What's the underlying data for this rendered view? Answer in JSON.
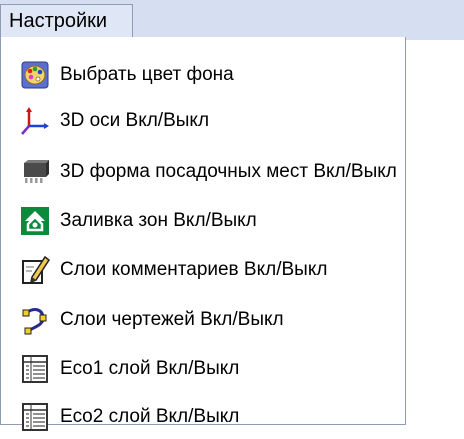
{
  "menu": {
    "title": "Настройки",
    "items": [
      {
        "label": "Выбрать цвет фона",
        "icon": "palette-icon"
      },
      {
        "label": "3D оси Вкл/Выкл",
        "icon": "3d-axes-icon"
      },
      {
        "label": "3D форма посадочных мест Вкл/Выкл",
        "icon": "3d-footprint-icon"
      },
      {
        "label": "Заливка зон Вкл/Выкл",
        "icon": "zone-fill-icon"
      },
      {
        "label": "Слои комментариев Вкл/Выкл",
        "icon": "comment-layer-icon"
      },
      {
        "label": "Слои чертежей Вкл/Выкл",
        "icon": "drawing-layer-icon"
      },
      {
        "label": "Eco1 слой Вкл/Выкл",
        "icon": "eco-layer-icon"
      },
      {
        "label": "Eco2 слой Вкл/Выкл",
        "icon": "eco-layer-icon"
      }
    ]
  },
  "colors": {
    "menu_bar": "#d6dff2",
    "border": "#8f9cb8",
    "background": "#ffffff"
  }
}
